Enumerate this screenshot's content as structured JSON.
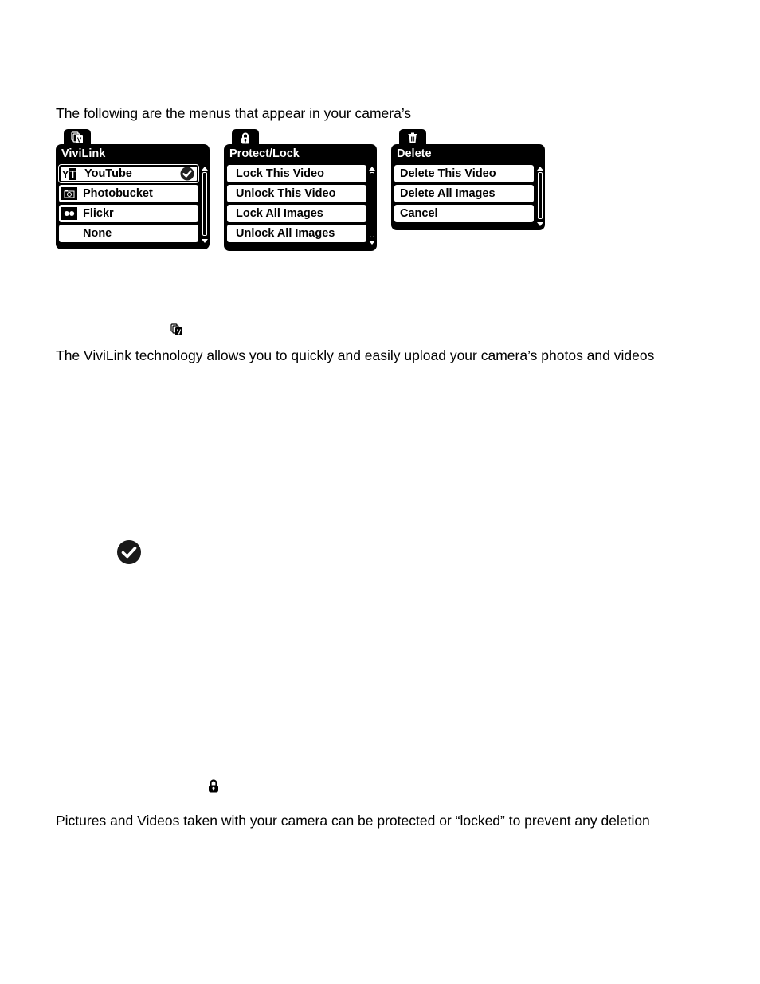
{
  "intro_text": "The following are the menus that appear in your camera’s",
  "menus": [
    {
      "id": "vivilink",
      "tab_icon": "vivilink-icon",
      "title": "ViviLink",
      "items": [
        {
          "label": "YouTube",
          "icon": "youtube-icon",
          "icon_text": "YT",
          "selected": true
        },
        {
          "label": "Photobucket",
          "icon": "photobucket-icon",
          "icon_text": "",
          "selected": false
        },
        {
          "label": "Flickr",
          "icon": "flickr-icon",
          "icon_text": "",
          "selected": false
        },
        {
          "label": "None",
          "icon": "",
          "icon_text": "",
          "selected": false
        }
      ]
    },
    {
      "id": "protect-lock",
      "tab_icon": "lock-icon",
      "title": "Protect/Lock",
      "items": [
        {
          "label": "Lock This Video"
        },
        {
          "label": "Unlock This Video"
        },
        {
          "label": "Lock All Images"
        },
        {
          "label": "Unlock All Images"
        }
      ]
    },
    {
      "id": "delete",
      "tab_icon": "trash-icon",
      "title": "Delete",
      "items": [
        {
          "label": "Delete This Video"
        },
        {
          "label": "Delete All Images"
        },
        {
          "label": "Cancel"
        }
      ]
    }
  ],
  "vivilink_section": {
    "icon": "vivilink-icon",
    "text": "The ViviLink technology allows you to quickly and easily upload your camera’s photos and videos",
    "selected_indicator_icon": "checkmark-circle-icon"
  },
  "protect_section": {
    "icon": "lock-icon",
    "text": "Pictures and Videos taken with your camera can be protected or “locked” to prevent any deletion"
  }
}
